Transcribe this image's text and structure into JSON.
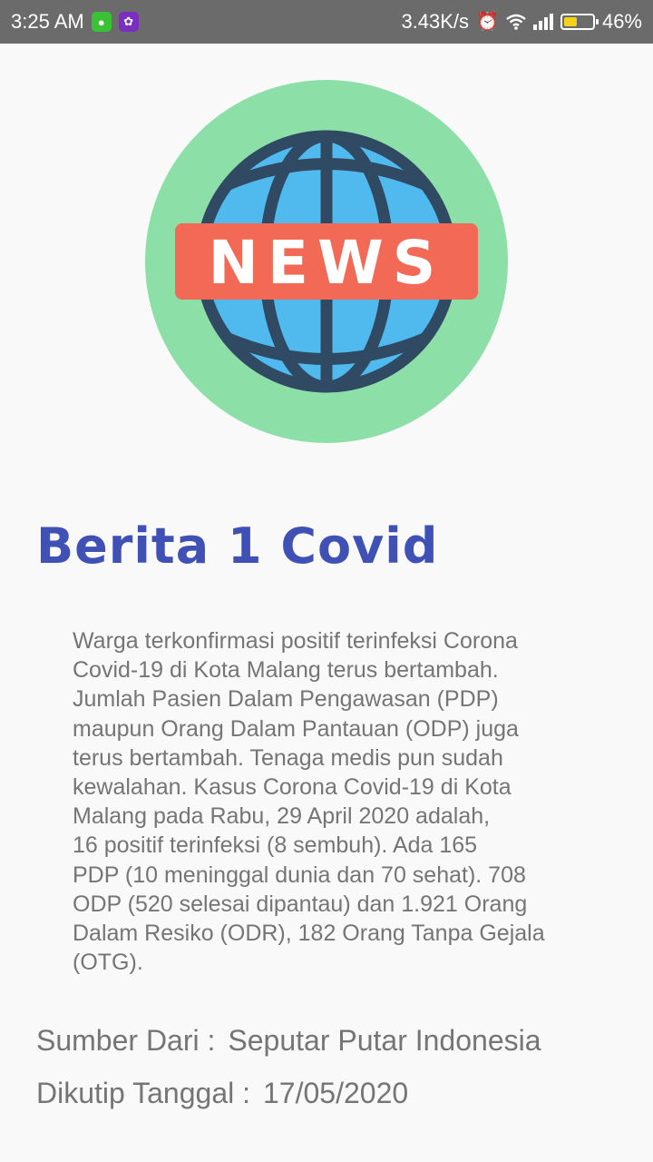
{
  "status_bar": {
    "time": "3:25 AM",
    "network_speed": "3.43K/s",
    "battery_percent": "46%",
    "battery_level": 0.46,
    "icons": [
      "message-icon",
      "uc-browser-icon",
      "alarm-icon",
      "wifi-icon",
      "signal-icon",
      "battery-icon"
    ]
  },
  "logo": {
    "text": "NEWS",
    "colors": {
      "circle": "#8ddfa8",
      "globe": "#50b9ee",
      "globe_lines": "#2f4a62",
      "banner": "#f26a55",
      "banner_text": "#ffffff"
    }
  },
  "article": {
    "title": "Berita 1 Covid",
    "body": "Warga terkonfirmasi positif terinfeksi Corona\nCovid-19 di Kota Malang terus bertambah.\nJumlah Pasien Dalam Pengawasan (PDP)\nmaupun Orang Dalam Pantauan (ODP) juga\nterus bertambah. Tenaga medis pun sudah\nkewalahan.  Kasus Corona Covid-19 di Kota\nMalang pada Rabu, 29 April 2020 adalah,\n16 positif terinfeksi (8 sembuh). Ada 165\nPDP (10 meninggal dunia dan 70 sehat). 708\nODP (520 selesai dipantau) dan 1.921 Orang\nDalam Resiko (ODR), 182 Orang Tanpa Gejala\n(OTG).",
    "source_label": "Sumber Dari :",
    "source_value": "Seputar Putar Indonesia",
    "date_label": "Dikutip Tanggal :",
    "date_value": "17/05/2020"
  },
  "colors": {
    "title": "#3f51b5",
    "text": "#757575",
    "background": "#f9f9f9",
    "status_bar": "#6b6b6b"
  }
}
